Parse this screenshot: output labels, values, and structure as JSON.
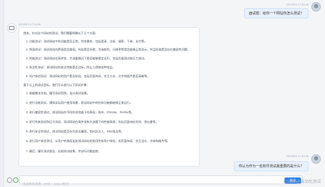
{
  "conversation": {
    "user_message_1": {
      "timestamp": "2023/5/3 17:24:46",
      "text": "面试题：给你一个网站你怎么测试？"
    },
    "bot_message": {
      "timestamp": "2023/5/3 17:24:46",
      "lines": [
        "首先，针对这个网站的测试，我们需要明确以下几个方面：",
        "1. 功能测试：测试网站中的功能是否正常，符合需求，包括登录、注册、搜索、下单、支付等。",
        "2. 界面测试：测试网站的界面是否美观，布局是否合理，字体颜色、分辨率等是否能够正常显示，并且检查是否存在兼容性问题。",
        "3. 性能测试：测试网站在高并发、大流量情况下是否能够稳定运行，包括负载测试和压力测试。",
        "4. 安全性测试：测试网站的安全性能是否达标，防止入侵和各种攻击。",
        "5. 用户体验测试：测试网站的用户是否舒适，包括页面布局、交互方式、文字和图片是否清晰等。",
        "基于以上的测试目标，我们可以进行以下测试步骤：",
        "1. 根据需求文档，编写测试用例，设计测试场景。",
        "2. 进行功能测试，模拟实际用户使用场景，保证网站中的所有功能都能够正常运行。",
        "3. 进行兼容性测试，测试网站在不同的浏览器下的表现，如IE、Chrome、Firefox等。",
        "4. 进行性能测试和压力测试，测试网站在高并发和大流量下的性能表现，包括页面响应时间、吞吐量等。",
        "5. 进行安全性测试，测试网站是否存在安全漏洞，如SQL注入、XSS攻击等。",
        "6. 进行用户体验测试，从用户的角度出发测试网站的易用性和用户体验，如页面布局、交互设计、字体和图片等。",
        "7. 最后，编写测试报告，总结测试结果，并进行问题追踪。"
      ]
    },
    "user_message_2": {
      "timestamp": "2023/5/3 17:24:46",
      "text": "你认为作为一名软件测试最重要的是什么？"
    }
  },
  "composer": {
    "placeholder": "发送你的消息（Shift + Enter 换行）",
    "send_label": "发送"
  },
  "watermark": "CSDN @自动化测试"
}
